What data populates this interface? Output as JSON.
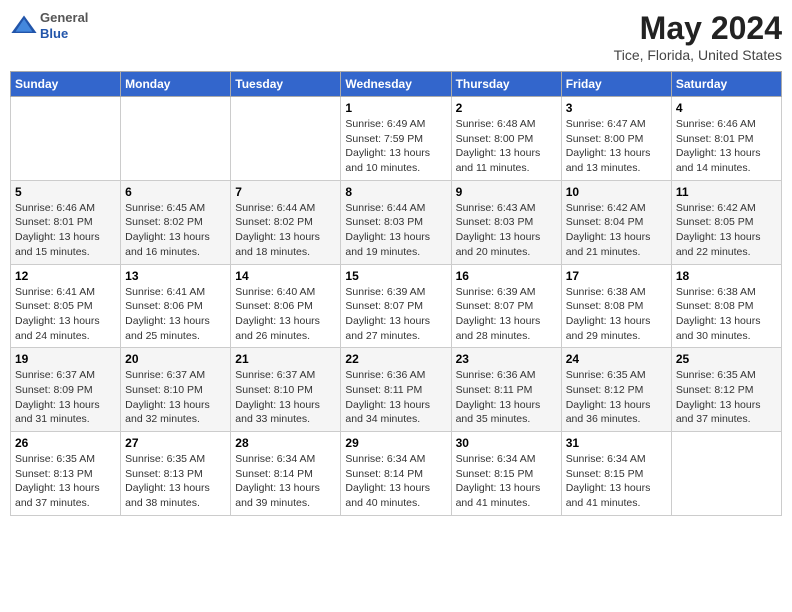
{
  "logo": {
    "general": "General",
    "blue": "Blue"
  },
  "title": "May 2024",
  "subtitle": "Tice, Florida, United States",
  "days_of_week": [
    "Sunday",
    "Monday",
    "Tuesday",
    "Wednesday",
    "Thursday",
    "Friday",
    "Saturday"
  ],
  "weeks": [
    [
      {
        "day": "",
        "info": ""
      },
      {
        "day": "",
        "info": ""
      },
      {
        "day": "",
        "info": ""
      },
      {
        "day": "1",
        "info": "Sunrise: 6:49 AM\nSunset: 7:59 PM\nDaylight: 13 hours\nand 10 minutes."
      },
      {
        "day": "2",
        "info": "Sunrise: 6:48 AM\nSunset: 8:00 PM\nDaylight: 13 hours\nand 11 minutes."
      },
      {
        "day": "3",
        "info": "Sunrise: 6:47 AM\nSunset: 8:00 PM\nDaylight: 13 hours\nand 13 minutes."
      },
      {
        "day": "4",
        "info": "Sunrise: 6:46 AM\nSunset: 8:01 PM\nDaylight: 13 hours\nand 14 minutes."
      }
    ],
    [
      {
        "day": "5",
        "info": "Sunrise: 6:46 AM\nSunset: 8:01 PM\nDaylight: 13 hours\nand 15 minutes."
      },
      {
        "day": "6",
        "info": "Sunrise: 6:45 AM\nSunset: 8:02 PM\nDaylight: 13 hours\nand 16 minutes."
      },
      {
        "day": "7",
        "info": "Sunrise: 6:44 AM\nSunset: 8:02 PM\nDaylight: 13 hours\nand 18 minutes."
      },
      {
        "day": "8",
        "info": "Sunrise: 6:44 AM\nSunset: 8:03 PM\nDaylight: 13 hours\nand 19 minutes."
      },
      {
        "day": "9",
        "info": "Sunrise: 6:43 AM\nSunset: 8:03 PM\nDaylight: 13 hours\nand 20 minutes."
      },
      {
        "day": "10",
        "info": "Sunrise: 6:42 AM\nSunset: 8:04 PM\nDaylight: 13 hours\nand 21 minutes."
      },
      {
        "day": "11",
        "info": "Sunrise: 6:42 AM\nSunset: 8:05 PM\nDaylight: 13 hours\nand 22 minutes."
      }
    ],
    [
      {
        "day": "12",
        "info": "Sunrise: 6:41 AM\nSunset: 8:05 PM\nDaylight: 13 hours\nand 24 minutes."
      },
      {
        "day": "13",
        "info": "Sunrise: 6:41 AM\nSunset: 8:06 PM\nDaylight: 13 hours\nand 25 minutes."
      },
      {
        "day": "14",
        "info": "Sunrise: 6:40 AM\nSunset: 8:06 PM\nDaylight: 13 hours\nand 26 minutes."
      },
      {
        "day": "15",
        "info": "Sunrise: 6:39 AM\nSunset: 8:07 PM\nDaylight: 13 hours\nand 27 minutes."
      },
      {
        "day": "16",
        "info": "Sunrise: 6:39 AM\nSunset: 8:07 PM\nDaylight: 13 hours\nand 28 minutes."
      },
      {
        "day": "17",
        "info": "Sunrise: 6:38 AM\nSunset: 8:08 PM\nDaylight: 13 hours\nand 29 minutes."
      },
      {
        "day": "18",
        "info": "Sunrise: 6:38 AM\nSunset: 8:08 PM\nDaylight: 13 hours\nand 30 minutes."
      }
    ],
    [
      {
        "day": "19",
        "info": "Sunrise: 6:37 AM\nSunset: 8:09 PM\nDaylight: 13 hours\nand 31 minutes."
      },
      {
        "day": "20",
        "info": "Sunrise: 6:37 AM\nSunset: 8:10 PM\nDaylight: 13 hours\nand 32 minutes."
      },
      {
        "day": "21",
        "info": "Sunrise: 6:37 AM\nSunset: 8:10 PM\nDaylight: 13 hours\nand 33 minutes."
      },
      {
        "day": "22",
        "info": "Sunrise: 6:36 AM\nSunset: 8:11 PM\nDaylight: 13 hours\nand 34 minutes."
      },
      {
        "day": "23",
        "info": "Sunrise: 6:36 AM\nSunset: 8:11 PM\nDaylight: 13 hours\nand 35 minutes."
      },
      {
        "day": "24",
        "info": "Sunrise: 6:35 AM\nSunset: 8:12 PM\nDaylight: 13 hours\nand 36 minutes."
      },
      {
        "day": "25",
        "info": "Sunrise: 6:35 AM\nSunset: 8:12 PM\nDaylight: 13 hours\nand 37 minutes."
      }
    ],
    [
      {
        "day": "26",
        "info": "Sunrise: 6:35 AM\nSunset: 8:13 PM\nDaylight: 13 hours\nand 37 minutes."
      },
      {
        "day": "27",
        "info": "Sunrise: 6:35 AM\nSunset: 8:13 PM\nDaylight: 13 hours\nand 38 minutes."
      },
      {
        "day": "28",
        "info": "Sunrise: 6:34 AM\nSunset: 8:14 PM\nDaylight: 13 hours\nand 39 minutes."
      },
      {
        "day": "29",
        "info": "Sunrise: 6:34 AM\nSunset: 8:14 PM\nDaylight: 13 hours\nand 40 minutes."
      },
      {
        "day": "30",
        "info": "Sunrise: 6:34 AM\nSunset: 8:15 PM\nDaylight: 13 hours\nand 41 minutes."
      },
      {
        "day": "31",
        "info": "Sunrise: 6:34 AM\nSunset: 8:15 PM\nDaylight: 13 hours\nand 41 minutes."
      },
      {
        "day": "",
        "info": ""
      }
    ]
  ]
}
